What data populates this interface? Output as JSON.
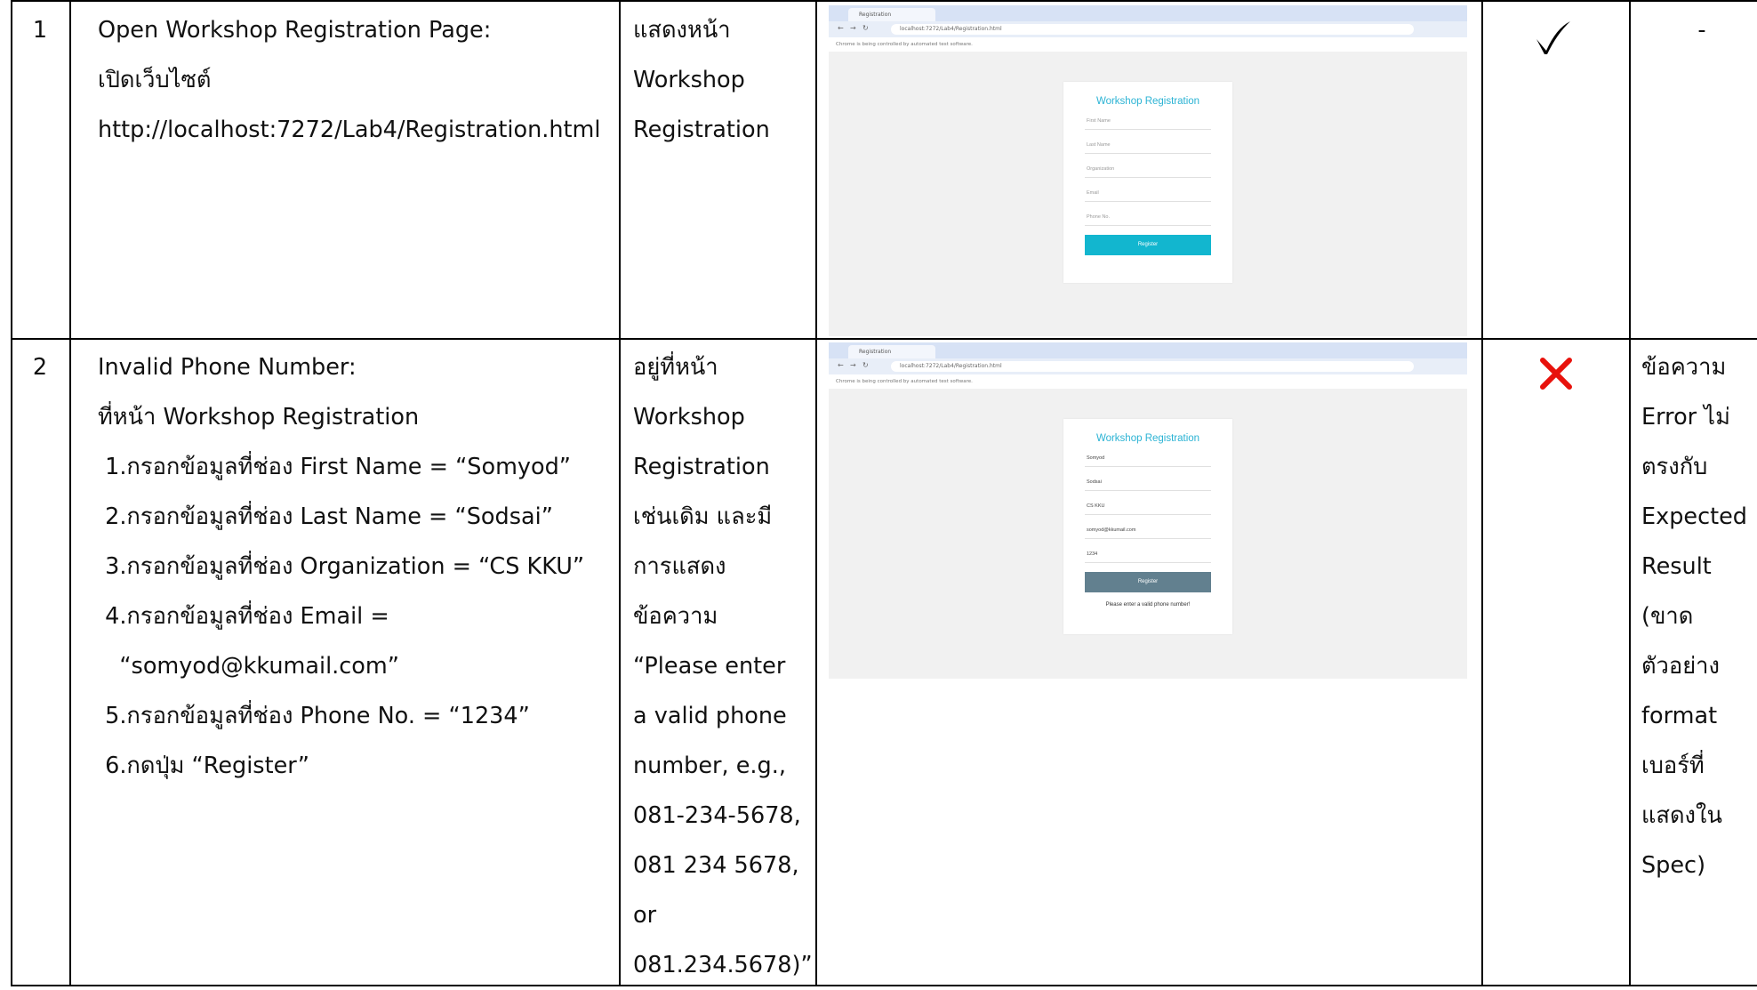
{
  "rows": [
    {
      "no": "1",
      "steps": [
        "Open Workshop Registration Page:",
        "เปิดเว็บไซต์",
        "http://localhost:7272/Lab4/Registration.html"
      ],
      "expected": [
        "แสดงหน้า",
        "Workshop",
        "Registration"
      ],
      "screenshot": {
        "tab_label": "Registration",
        "url": "localhost:7272/Lab4/Registration.html",
        "infobar": "Chrome is being controlled by automated test software.",
        "card_title": "Workshop Registration",
        "fields": [
          "First Name",
          "Last Name",
          "Organization",
          "Email",
          "Phone No."
        ],
        "button": "Register",
        "button_color": "#12b6cf",
        "error": ""
      },
      "result": "pass",
      "result_icon": "check-icon",
      "remark": [
        "-"
      ]
    },
    {
      "no": "2",
      "steps": [
        "Invalid Phone Number:",
        "ที่หน้า Workshop Registration",
        " 1.กรอกข้อมูลที่ช่อง First Name = “Somyod”",
        " 2.กรอกข้อมูลที่ช่อง Last Name = “Sodsai”",
        " 3.กรอกข้อมูลที่ช่อง Organization = “CS KKU”",
        " 4.กรอกข้อมูลที่ช่อง Email =",
        "   “somyod@kkumail.com”",
        " 5.กรอกข้อมูลที่ช่อง Phone No. = “1234”",
        " 6.กดปุ่ม “Register”"
      ],
      "expected": [
        "อยู่ที่หน้า",
        "Workshop",
        "Registration",
        "เช่นเดิม และมี",
        "การแสดง",
        "ข้อความ",
        "“Please enter",
        "a valid phone",
        "number, e.g.,",
        "081-234-5678,",
        "081 234 5678,",
        "or",
        "081.234.5678)”"
      ],
      "screenshot": {
        "tab_label": "Registration",
        "url": "localhost:7272/Lab4/Registration.html",
        "infobar": "Chrome is being controlled by automated test software.",
        "card_title": "Workshop Registration",
        "fields": [
          "Somyod",
          "Sodsai",
          "CS KKU",
          "somyod@kkumail.com",
          "1234"
        ],
        "button": "Register",
        "button_color": "#62808f",
        "error": "Please enter a valid phone number!"
      },
      "result": "fail",
      "result_icon": "cross-icon",
      "remark": [
        "ข้อความ",
        "Error ไม่",
        "ตรงกับ",
        "Expected",
        "Result",
        "(ขาด",
        "ตัวอย่าง",
        "format",
        "เบอร์ที่",
        "แสดงใน",
        "Spec)"
      ]
    }
  ],
  "colors": {
    "check": "#000000",
    "cross": "#e8120c"
  }
}
